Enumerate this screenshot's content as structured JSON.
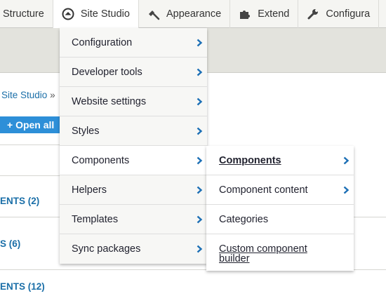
{
  "toolbar": {
    "items": [
      {
        "label": "Structure",
        "icon": "structure-icon"
      },
      {
        "label": "Site Studio",
        "icon": "site-studio-icon"
      },
      {
        "label": "Appearance",
        "icon": "paintbrush-icon"
      },
      {
        "label": "Extend",
        "icon": "puzzle-icon"
      },
      {
        "label": "Configura",
        "icon": "wrench-icon"
      }
    ]
  },
  "page": {
    "breadcrumb": {
      "link": "Site Studio",
      "separator": "»"
    },
    "open_all_button": "+ Open all",
    "sections": [
      "ENTS (2)",
      "S (6)",
      "ENTS (12)"
    ]
  },
  "site_studio_menu": {
    "items": [
      {
        "label": "Configuration",
        "has_submenu": true
      },
      {
        "label": "Developer tools",
        "has_submenu": true
      },
      {
        "label": "Website settings",
        "has_submenu": true
      },
      {
        "label": "Styles",
        "has_submenu": true
      },
      {
        "label": "Components",
        "has_submenu": true,
        "highlighted": true
      },
      {
        "label": "Helpers",
        "has_submenu": true
      },
      {
        "label": "Templates",
        "has_submenu": true
      },
      {
        "label": "Sync packages",
        "has_submenu": true
      }
    ]
  },
  "components_submenu": {
    "items": [
      {
        "label": "Components",
        "has_submenu": true
      },
      {
        "label": "Component content",
        "has_submenu": true
      },
      {
        "label": "Categories",
        "has_submenu": false
      },
      {
        "label": "Custom component builder",
        "has_submenu": false
      }
    ]
  },
  "colors": {
    "link_blue": "#1b6fa8",
    "button_blue": "#2d8fd8",
    "chevron_blue": "#1c6fb5",
    "toolbar_bg": "#f5f5f2",
    "menu_bg": "#f7f7f5"
  }
}
